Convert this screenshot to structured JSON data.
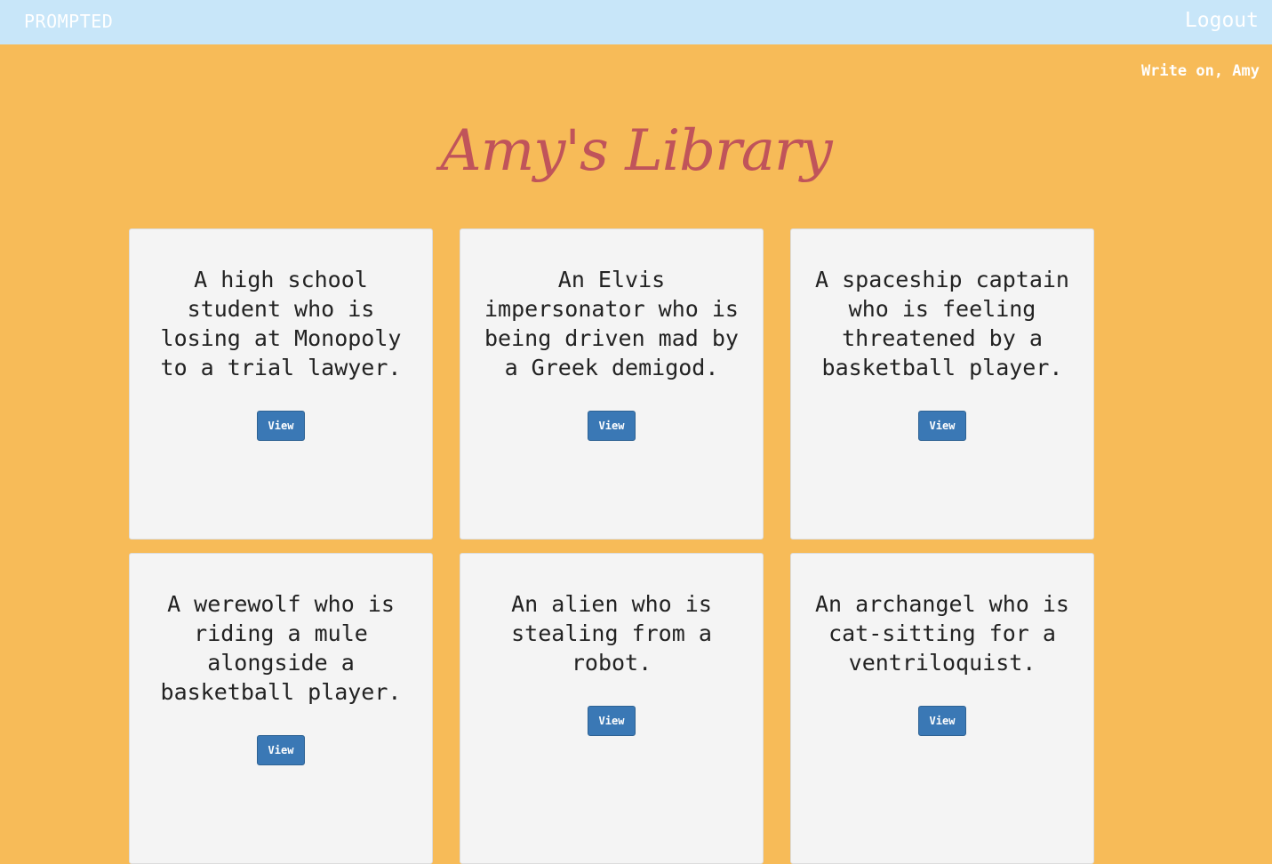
{
  "nav": {
    "brand": "PROMPTED",
    "logout_label": "Logout"
  },
  "greeting": "Write on, Amy",
  "page_title": "Amy's Library",
  "cards": [
    {
      "prompt": "A high school student who is losing at Monopoly to a trial lawyer.",
      "button": "View"
    },
    {
      "prompt": "An Elvis impersonator who is being driven mad by a Greek demigod.",
      "button": "View"
    },
    {
      "prompt": "A spaceship captain who is feeling threatened by a basketball player.",
      "button": "View"
    },
    {
      "prompt": "A werewolf who is riding a mule alongside a basketball player.",
      "button": "View"
    },
    {
      "prompt": "An alien who is stealing from a robot.",
      "button": "View"
    },
    {
      "prompt": "An archangel who is cat-sitting for a ventriloquist.",
      "button": "View"
    }
  ],
  "colors": {
    "background": "#f7bb58",
    "navbar": "#c8e6f9",
    "title": "#c0545a",
    "button": "#3a78b5",
    "card": "#f4f4f4"
  }
}
